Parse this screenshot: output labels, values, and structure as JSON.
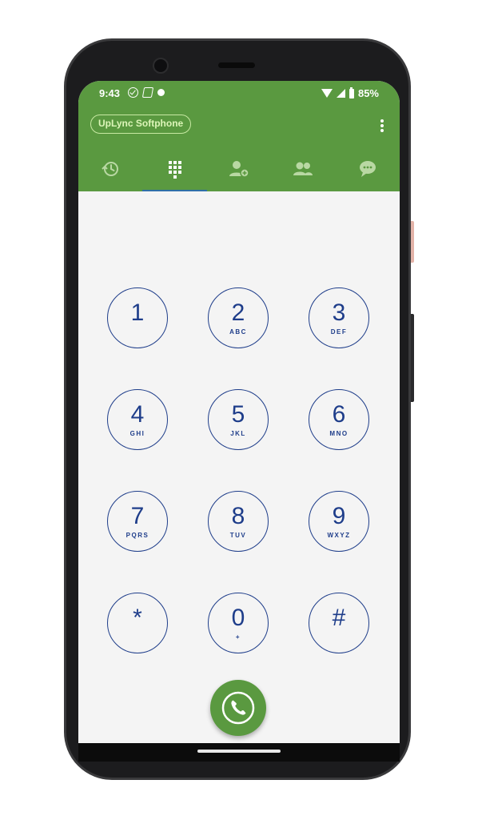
{
  "status_bar": {
    "time": "9:43",
    "battery": "85%"
  },
  "toolbar": {
    "title": "UpLync Softphone",
    "menu_icon": "more-vert-icon"
  },
  "tabs": [
    {
      "name": "recents",
      "icon": "history-icon",
      "active": false
    },
    {
      "name": "dialpad",
      "icon": "dialpad-icon",
      "active": true
    },
    {
      "name": "add-contact",
      "icon": "person-add-icon",
      "active": false
    },
    {
      "name": "contacts",
      "icon": "people-icon",
      "active": false
    },
    {
      "name": "messages",
      "icon": "chat-icon",
      "active": false
    }
  ],
  "keypad": [
    {
      "digit": "1",
      "letters": ""
    },
    {
      "digit": "2",
      "letters": "ABC"
    },
    {
      "digit": "3",
      "letters": "DEF"
    },
    {
      "digit": "4",
      "letters": "GHI"
    },
    {
      "digit": "5",
      "letters": "JKL"
    },
    {
      "digit": "6",
      "letters": "MNO"
    },
    {
      "digit": "7",
      "letters": "PQRS"
    },
    {
      "digit": "8",
      "letters": "TUV"
    },
    {
      "digit": "9",
      "letters": "WXYZ"
    },
    {
      "digit": "*",
      "letters": ""
    },
    {
      "digit": "0",
      "letters": "+"
    },
    {
      "digit": "#",
      "letters": ""
    }
  ],
  "call_button": {
    "icon": "phone-call-icon"
  },
  "colors": {
    "accent_green": "#5a9940",
    "key_blue": "#1e3d8a",
    "tab_indicator": "#2f6fa8",
    "title_green": "#dcf5b8"
  }
}
